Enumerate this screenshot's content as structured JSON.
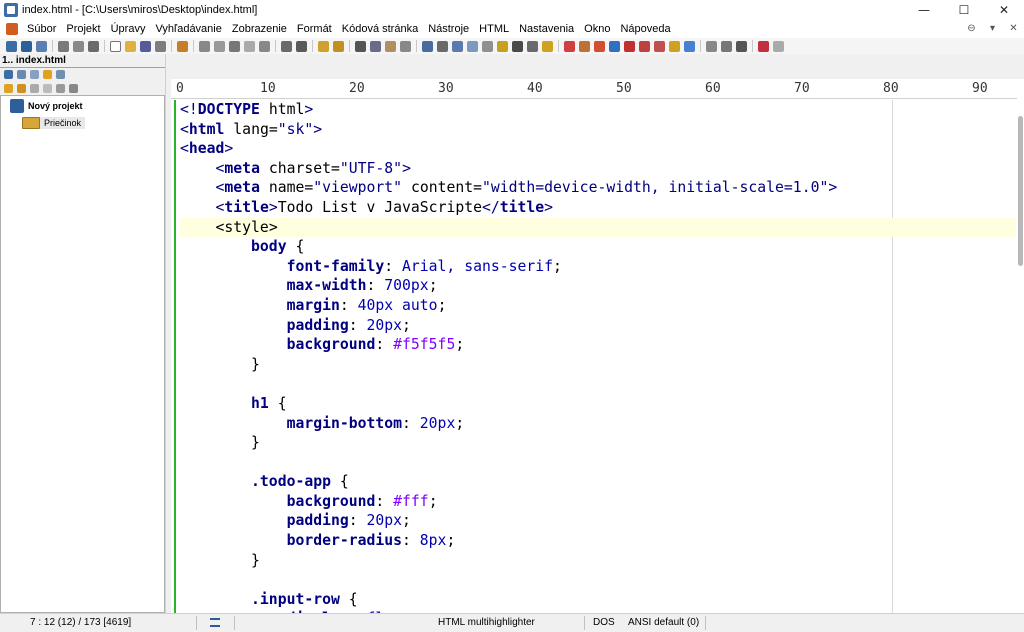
{
  "window": {
    "title": "index.html - [C:\\Users\\miros\\Desktop\\index.html]",
    "controls": [
      "—",
      "☐",
      "✕"
    ]
  },
  "menu": {
    "items": [
      "Súbor",
      "Projekt",
      "Úpravy",
      "Vyhľadávanie",
      "Zobrazenie",
      "Formát",
      "Kódová stránka",
      "Nástroje",
      "HTML",
      "Nastavenia",
      "Okno",
      "Nápoveda"
    ],
    "right": [
      "⊖",
      "▾",
      "✕"
    ]
  },
  "tab": {
    "label": "1.. index.html"
  },
  "sidebar": {
    "project": "Nový projekt",
    "folder": "Priečinok"
  },
  "ruler": {
    "labels": [
      "0",
      "10",
      "20",
      "30",
      "40",
      "50",
      "60",
      "70",
      "80",
      "90"
    ]
  },
  "editor": {
    "current_line": 7,
    "lines": [
      "<!DOCTYPE html>",
      "<html lang=\"sk\">",
      "<head>",
      "    <meta charset=\"UTF-8\">",
      "    <meta name=\"viewport\" content=\"width=device-width, initial-scale=1.0\">",
      "    <title>Todo List v JavaScripte</title>",
      "    <style>",
      "        body {",
      "            font-family: Arial, sans-serif;",
      "            max-width: 700px;",
      "            margin: 40px auto;",
      "            padding: 20px;",
      "            background: #f5f5f5;",
      "        }",
      "",
      "        h1 {",
      "            margin-bottom: 20px;",
      "        }",
      "",
      "        .todo-app {",
      "            background: #fff;",
      "            padding: 20px;",
      "            border-radius: 8px;",
      "        }",
      "",
      "        .input-row {",
      "            display: flex;"
    ]
  },
  "status": {
    "position": "7 : 12 (12) / 173  [4619]",
    "highlighter": "HTML multihighlighter",
    "line_ending": "DOS",
    "encoding": "ANSI default (0)"
  },
  "colors": {
    "gutter": "#28b428",
    "current_line": "#ffffe0",
    "tag": "#000080",
    "value": "#0000b0",
    "color_value": "#8000ff"
  }
}
